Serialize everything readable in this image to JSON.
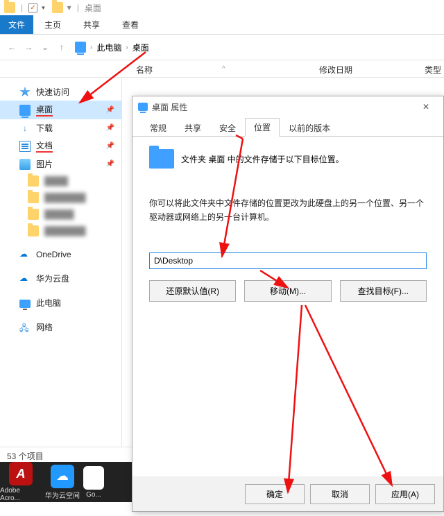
{
  "titlebar": {
    "title": "桌面",
    "sep": "|",
    "caret": "▾",
    "check": "✓"
  },
  "ribbon": {
    "file": "文件",
    "home": "主页",
    "share": "共享",
    "view": "查看"
  },
  "nav": {
    "back": "←",
    "fwd": "→",
    "up": "↑",
    "dropdown": "⌄"
  },
  "breadcrumb": {
    "root": "此电脑",
    "sep": "›",
    "leaf": "桌面"
  },
  "columns": {
    "name": "名称",
    "date": "修改日期",
    "type": "类型",
    "caret": "^"
  },
  "sidebar": {
    "quick": "快速访问",
    "desktop": "桌面",
    "downloads": "下载",
    "documents": "文档",
    "pictures": "图片",
    "onedrive": "OneDrive",
    "huawei": "华为云盘",
    "thispc": "此电脑",
    "network": "网络",
    "blur1": "████",
    "blur2": "███████",
    "blur3": "█████",
    "blur4": "███████",
    "pin": "📌"
  },
  "status": {
    "count": "53 个项目"
  },
  "taskbar": {
    "app1": "Adobe Acro...",
    "app2": "华为云空间",
    "app3": "Go..."
  },
  "dialog": {
    "title": "桌面 属性",
    "close": "✕",
    "tabs": {
      "general": "常规",
      "share": "共享",
      "security": "安全",
      "location": "位置",
      "prev": "以前的版本"
    },
    "line1": "文件夹 桌面 中的文件存储于以下目标位置。",
    "line2": "你可以将此文件夹中文件存储的位置更改为此硬盘上的另一个位置、另一个驱动器或网络上的另一台计算机。",
    "path": "D\\Desktop",
    "restore": "还原默认值(R)",
    "move": "移动(M)...",
    "find": "查找目标(F)...",
    "ok": "确定",
    "cancel": "取消",
    "apply": "应用(A)"
  }
}
